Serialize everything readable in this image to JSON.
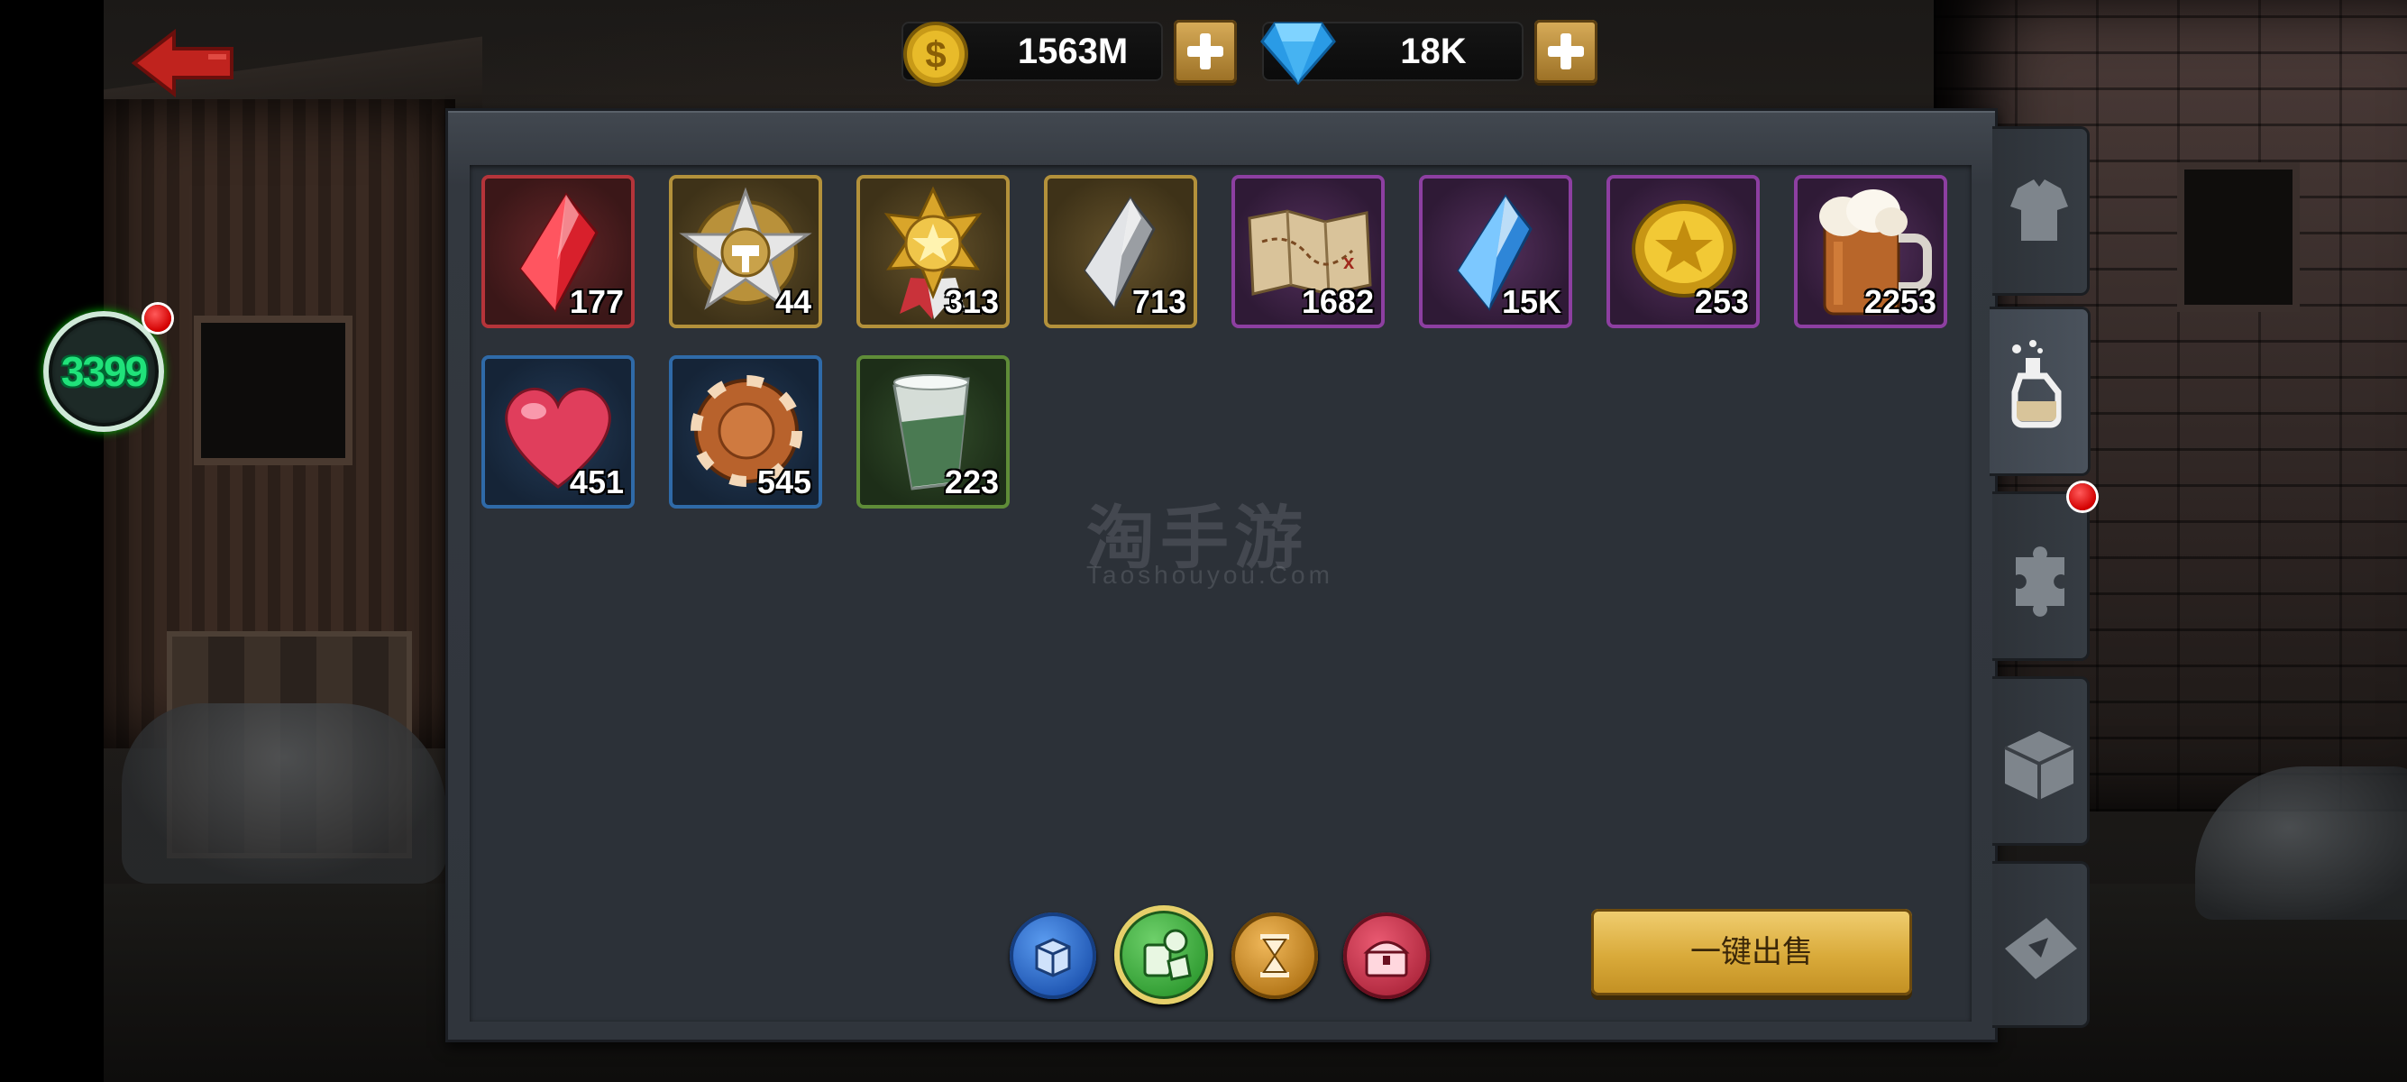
{
  "header": {
    "gold": {
      "icon": "gold-coin-icon",
      "value": "1563M"
    },
    "gems": {
      "icon": "diamond-icon",
      "value": "18K"
    }
  },
  "player": {
    "level": "3399"
  },
  "inventory": {
    "items": [
      {
        "name": "red-crystal",
        "rarity": "red",
        "count": "177"
      },
      {
        "name": "silver-star-hammer-medal",
        "rarity": "gold",
        "count": "44"
      },
      {
        "name": "gold-star-medal",
        "rarity": "gold",
        "count": "313"
      },
      {
        "name": "silver-crystal",
        "rarity": "gold",
        "count": "713"
      },
      {
        "name": "treasure-map",
        "rarity": "purple",
        "count": "1682"
      },
      {
        "name": "blue-crystal",
        "rarity": "purple",
        "count": "15K"
      },
      {
        "name": "gold-star-coin",
        "rarity": "purple",
        "count": "253"
      },
      {
        "name": "beer-mug",
        "rarity": "purple",
        "count": "2253"
      },
      {
        "name": "pink-heart",
        "rarity": "blue",
        "count": "451"
      },
      {
        "name": "bronze-chip",
        "rarity": "blue",
        "count": "545"
      },
      {
        "name": "shot-glass",
        "rarity": "green",
        "count": "223"
      }
    ]
  },
  "watermark": {
    "cn": "淘手游",
    "en": "Taoshouyou.Com"
  },
  "filters": [
    {
      "name": "package-filter",
      "color": "#2f6ad0"
    },
    {
      "name": "consumable-filter",
      "color": "#3aa43a",
      "selected": true
    },
    {
      "name": "timer-filter",
      "color": "#c8861c"
    },
    {
      "name": "chest-filter",
      "color": "#c8344a"
    }
  ],
  "actions": {
    "sell_all_label": "一键出售"
  },
  "side_tabs": [
    {
      "name": "equipment",
      "icon": "shirt-icon"
    },
    {
      "name": "consumables",
      "icon": "potion-icon",
      "active": true
    },
    {
      "name": "fragments",
      "icon": "puzzle-icon",
      "badge": true
    },
    {
      "name": "materials",
      "icon": "box-icon"
    },
    {
      "name": "tickets",
      "icon": "ticket-icon"
    }
  ],
  "colors": {
    "sell_button": "#d9aa3a",
    "level_text": "#20e27a",
    "panel": "#30353c"
  }
}
